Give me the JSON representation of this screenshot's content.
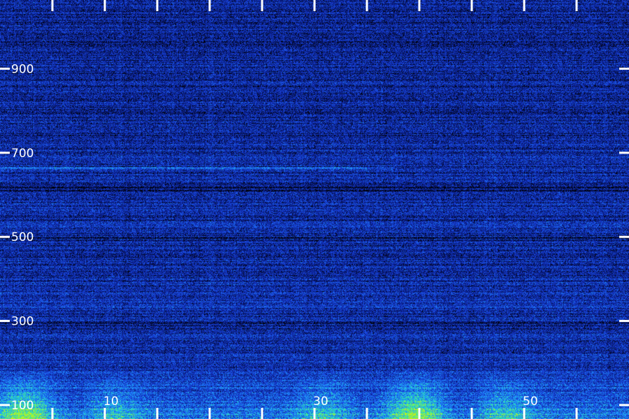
{
  "chart_data": {
    "type": "heatmap",
    "title": "",
    "xlabel": "",
    "ylabel": "",
    "x_range": [
      0,
      60
    ],
    "y_range": [
      100,
      1080
    ],
    "x_major_ticks": [
      0,
      5,
      10,
      15,
      20,
      25,
      30,
      35,
      40,
      45,
      50,
      55,
      60
    ],
    "x_tick_labels": [
      {
        "value": 10,
        "label": "10"
      },
      {
        "value": 30,
        "label": "30"
      },
      {
        "value": 50,
        "label": "50"
      }
    ],
    "y_tick_labels": [
      {
        "value": 100,
        "label": "100"
      },
      {
        "value": 300,
        "label": "300"
      },
      {
        "value": 500,
        "label": "500"
      },
      {
        "value": 700,
        "label": "700"
      },
      {
        "value": 900,
        "label": "900"
      }
    ],
    "colormap": [
      "#000000",
      "#0a1e8c",
      "#1a46e0",
      "#1ea0ff",
      "#32f0a0",
      "#d2f00a"
    ],
    "features": [
      {
        "kind": "tone",
        "y": 664,
        "x_range": [
          0,
          35
        ],
        "description": "faint horizontal tone"
      },
      {
        "kind": "low-frequency energy",
        "y_range": [
          100,
          160
        ],
        "description": "strong energy band near bottom"
      }
    ],
    "grid": false
  }
}
